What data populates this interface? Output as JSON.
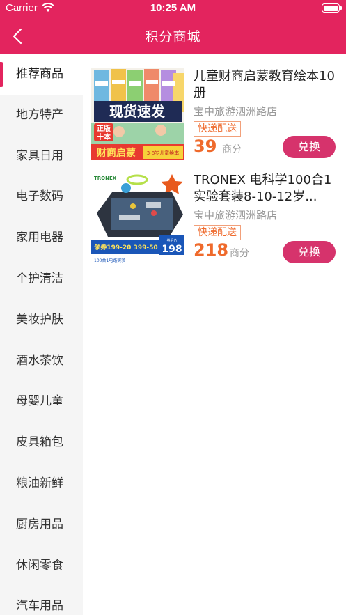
{
  "status_bar": {
    "carrier": "Carrier",
    "time": "10:25 AM"
  },
  "header": {
    "title": "积分商城"
  },
  "sidebar": {
    "items": [
      {
        "label": "推荐商品"
      },
      {
        "label": "地方特产"
      },
      {
        "label": "家具日用"
      },
      {
        "label": "电子数码"
      },
      {
        "label": "家用电器"
      },
      {
        "label": "个护清洁"
      },
      {
        "label": "美妆护肤"
      },
      {
        "label": "酒水茶饮"
      },
      {
        "label": "母婴儿童"
      },
      {
        "label": "皮具箱包"
      },
      {
        "label": "粮油新鲜"
      },
      {
        "label": "厨房用品"
      },
      {
        "label": "休闲零食"
      },
      {
        "label": "汽车用品"
      }
    ]
  },
  "products": [
    {
      "name": "儿童财商启蒙教育绘本10册",
      "shop": "宝中旅游泗洲路店",
      "tag": "快递配送",
      "price": "39",
      "unit": "商分",
      "button": "兑换",
      "image": {
        "banner": "现货速发",
        "badge_line1": "正版",
        "badge_line2": "十本",
        "bottom_title": "财商启蒙",
        "bottom_sub": "3-8岁儿童绘本"
      }
    },
    {
      "name": "TRONEX 电科学100合1实验套装8-10-12岁...",
      "shop": "宝中旅游泗洲路店",
      "tag": "快递配送",
      "price": "218",
      "unit": "商分",
      "button": "兑换",
      "image": {
        "coupon": "领券199-20 399-50",
        "price_label": "券后价",
        "price_value": "198",
        "small_text": "100合1电路实验",
        "brand": "TRONEX"
      }
    }
  ],
  "colors": {
    "primary": "#e3245e",
    "button": "#d6336c",
    "price": "#ef6a2c"
  }
}
